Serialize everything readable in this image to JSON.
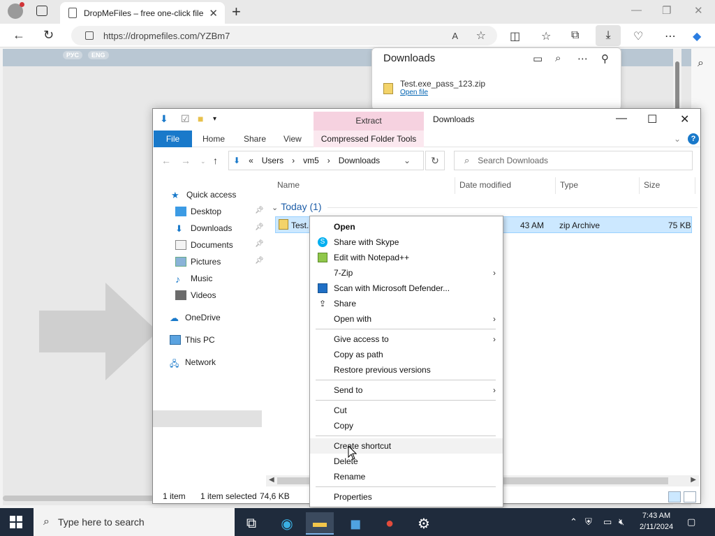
{
  "browser": {
    "tab_title": "DropMeFiles – free one-click file",
    "url": "https://dropmefiles.com/YZBm7",
    "read_aloud": "A",
    "new_tab": "+",
    "tab_close": "✕"
  },
  "webpage": {
    "lang_ru": "РУС",
    "lang_en": "ENG"
  },
  "downloads": {
    "title": "Downloads",
    "file_name": "Test.exe_pass_123.zip",
    "open_file": "Open file"
  },
  "explorer": {
    "extract_tab": "Extract",
    "title": "Downloads",
    "ribbon": {
      "file": "File",
      "home": "Home",
      "share": "Share",
      "view": "View",
      "compressed": "Compressed Folder Tools"
    },
    "path": [
      "«",
      "Users",
      "›",
      "vm5",
      "›",
      "Downloads"
    ],
    "search_placeholder": "Search Downloads",
    "nav": {
      "quick_access": "Quick access",
      "desktop": "Desktop",
      "downloads": "Downloads",
      "documents": "Documents",
      "pictures": "Pictures",
      "music": "Music",
      "videos": "Videos",
      "onedrive": "OneDrive",
      "this_pc": "This PC",
      "network": "Network"
    },
    "columns": {
      "name": "Name",
      "date": "Date modified",
      "type": "Type",
      "size": "Size"
    },
    "group_label": "Today (1)",
    "file": {
      "name": "Test.e",
      "time": "43 AM",
      "type": "zip Archive",
      "size": "75 KB"
    },
    "status": {
      "items": "1 item",
      "selected": "1 item selected",
      "sel_size": "74,6 KB"
    }
  },
  "context_menu": {
    "items": [
      {
        "label": "Open",
        "bold": true
      },
      {
        "label": "Share with Skype"
      },
      {
        "label": "Edit with Notepad++"
      },
      {
        "label": "7-Zip"
      },
      {
        "label": "Scan with Microsoft Defender..."
      },
      {
        "label": "Share"
      },
      {
        "label": "Open with"
      },
      {
        "label": "Give access to"
      },
      {
        "label": "Copy as path"
      },
      {
        "label": "Restore previous versions"
      },
      {
        "label": "Send to"
      },
      {
        "label": "Cut"
      },
      {
        "label": "Copy"
      },
      {
        "label": "Create shortcut"
      },
      {
        "label": "Delete"
      },
      {
        "label": "Rename"
      },
      {
        "label": "Properties"
      }
    ]
  },
  "taskbar": {
    "search_placeholder": "Type here to search",
    "time": "7:43 AM",
    "date": "2/11/2024"
  },
  "colors": {
    "ribbon_blue": "#1979ca",
    "extract_pink": "#f6d2e0",
    "selection": "#cce8ff",
    "taskbar": "#1f2b3c"
  }
}
